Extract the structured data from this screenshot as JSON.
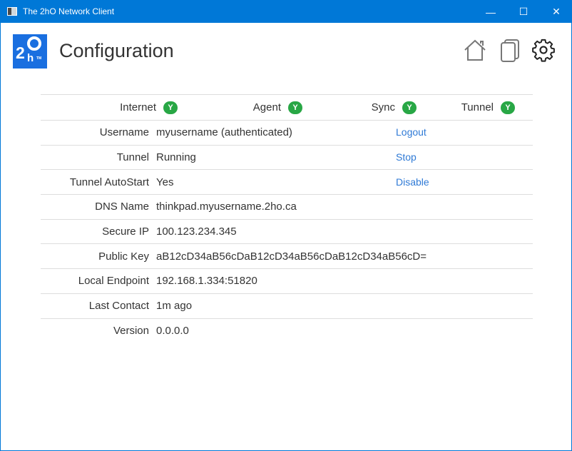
{
  "window": {
    "title": "The 2hO Network Client",
    "minimize": "—",
    "maximize": "☐",
    "close": "✕"
  },
  "header": {
    "logo_text": "2hO",
    "title": "Configuration",
    "icons": [
      "home-icon",
      "copy-icon",
      "gear-icon"
    ]
  },
  "status": [
    {
      "label": "Internet",
      "value": "Y"
    },
    {
      "label": "Agent",
      "value": "Y"
    },
    {
      "label": "Sync",
      "value": "Y"
    },
    {
      "label": "Tunnel",
      "value": "Y"
    }
  ],
  "status_color": "#28a745",
  "rows": [
    {
      "label": "Username",
      "value": "myusername (authenticated)",
      "action": "Logout"
    },
    {
      "label": "Tunnel",
      "value": "Running",
      "action": "Stop"
    },
    {
      "label": "Tunnel AutoStart",
      "value": "Yes",
      "action": "Disable"
    },
    {
      "label": "DNS Name",
      "value": "thinkpad.myusername.2ho.ca"
    },
    {
      "label": "Secure IP",
      "value": "100.123.234.345"
    },
    {
      "label": "Public Key",
      "value": "aB12cD34aB56cDaB12cD34aB56cDaB12cD34aB56cD="
    },
    {
      "label": "Local Endpoint",
      "value": "192.168.1.334:51820"
    },
    {
      "label": "Last Contact",
      "value": "1m ago"
    },
    {
      "label": "Version",
      "value": "0.0.0.0"
    }
  ]
}
